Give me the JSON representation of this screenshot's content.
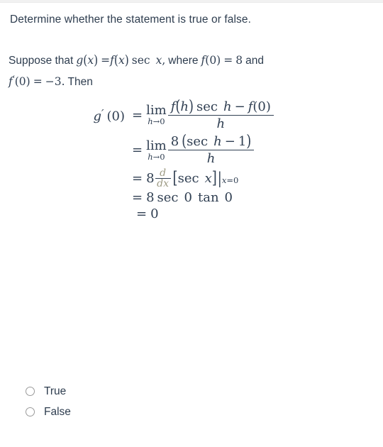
{
  "prompt": {
    "text": "Determine whether the statement is true or false."
  },
  "supposition": {
    "lead": "Suppose that",
    "g_var": "g",
    "lparen1": "(",
    "x1": "x",
    "rparen1": ")",
    "eq1": "=",
    "f_var": "f",
    "lparen2": "(",
    "x2": "x",
    "rparen2": ")",
    "sec": "sec",
    "x3": "x",
    "comma": ",",
    "where": "where",
    "f2": "f",
    "f2_arg": "(0)",
    "eq2": "=",
    "eight": "8",
    "and": "and",
    "fprime": "f",
    "prime": "′",
    "fprime_arg": "(0)",
    "eq3": "=",
    "minus_three": "−3.",
    "then": "Then"
  },
  "derivation": {
    "lhs": {
      "g": "g",
      "prime": "′",
      "arg": "(0)"
    },
    "line1": {
      "eq": "=",
      "lim": "lim",
      "lim_sub_var": "h",
      "lim_sub_arrow": "→0",
      "num_f": "f",
      "num_lparen": "(",
      "num_h": "h",
      "num_rparen": ")",
      "num_sec": "sec",
      "num_h2": "h",
      "num_minus": "−",
      "num_f2": "f",
      "num_zero": "(0)",
      "den": "h"
    },
    "line2": {
      "eq": "=",
      "lim": "lim",
      "lim_sub_var": "h",
      "lim_sub_arrow": "→0",
      "num_eight": "8",
      "num_lparen": "(",
      "num_sec": "sec",
      "num_h": "h",
      "num_minus": "−",
      "num_one": "1",
      "num_rparen": ")",
      "den": "h"
    },
    "line3": {
      "eq": "=",
      "eight": "8",
      "d_num": "d",
      "d_den": "dx",
      "lbracket": "[",
      "sec": "sec",
      "x": "x",
      "rbracket": "]",
      "vbar": "|",
      "eval_x": "x",
      "eval_eq": "=0"
    },
    "line4": {
      "eq": "=",
      "eight": "8",
      "sec": "sec",
      "zero1": "0",
      "tan": "tan",
      "zero2": "0"
    },
    "line5": {
      "eq": "=",
      "zero": "0"
    }
  },
  "options": [
    {
      "label": "True",
      "selected": false
    },
    {
      "label": "False",
      "selected": false
    }
  ],
  "colors": {
    "text": "#2e3d4f",
    "math": "#303f52",
    "d_dx_accent": "#9d9b84",
    "radio_border": "#9a9a9a",
    "top_rule": "#f1f1f1",
    "background": "#ffffff"
  }
}
